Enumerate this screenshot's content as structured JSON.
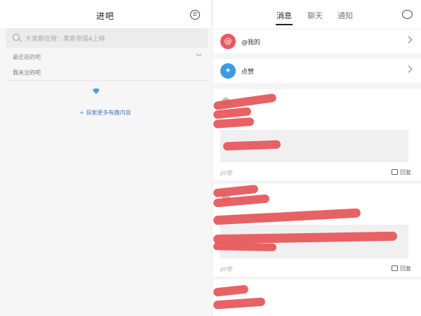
{
  "left": {
    "title": "进吧",
    "search_placeholder": "大家都在搜：黑客帝国4上映",
    "recent_label": "最近逛的吧",
    "recent_toggle": "︾",
    "follow_label": "我关注的吧",
    "explore_label": "+ 探索更多有趣内容"
  },
  "right": {
    "tabs": [
      {
        "label": "消息",
        "active": true
      },
      {
        "label": "聊天",
        "active": false
      },
      {
        "label": "通知",
        "active": false
      }
    ],
    "notifications": [
      {
        "label": "@我的",
        "icon": "at-icon",
        "color": "#e9585c"
      },
      {
        "label": "点赞",
        "icon": "like-icon",
        "color": "#3d9be0"
      }
    ],
    "posts": [
      {
        "source": "pt吧",
        "reply_label": "回复"
      },
      {
        "source": "pt吧",
        "reply_label": "回复"
      }
    ]
  }
}
